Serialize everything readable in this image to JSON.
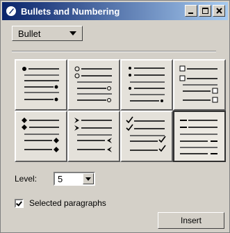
{
  "window": {
    "title": "Bullets and Numbering",
    "buttons": {
      "minimize": "_",
      "maximize": "□",
      "close": "×"
    }
  },
  "format_type": {
    "selected": "Bullet"
  },
  "bullet_styles": [
    {
      "style": "solid-dot-bullets"
    },
    {
      "style": "hollow-circle-bullets"
    },
    {
      "style": "small-dot-bullets"
    },
    {
      "style": "square-box-bullets"
    },
    {
      "style": "diamond-bullets"
    },
    {
      "style": "arrow-bullets"
    },
    {
      "style": "checkmark-bullets"
    },
    {
      "style": "dash-bullets",
      "selected": true
    }
  ],
  "level": {
    "label": "Level:",
    "value": "5"
  },
  "selected_paragraphs": {
    "label": "Selected paragraphs",
    "checked": true
  },
  "insert_button": {
    "label": "Insert"
  }
}
